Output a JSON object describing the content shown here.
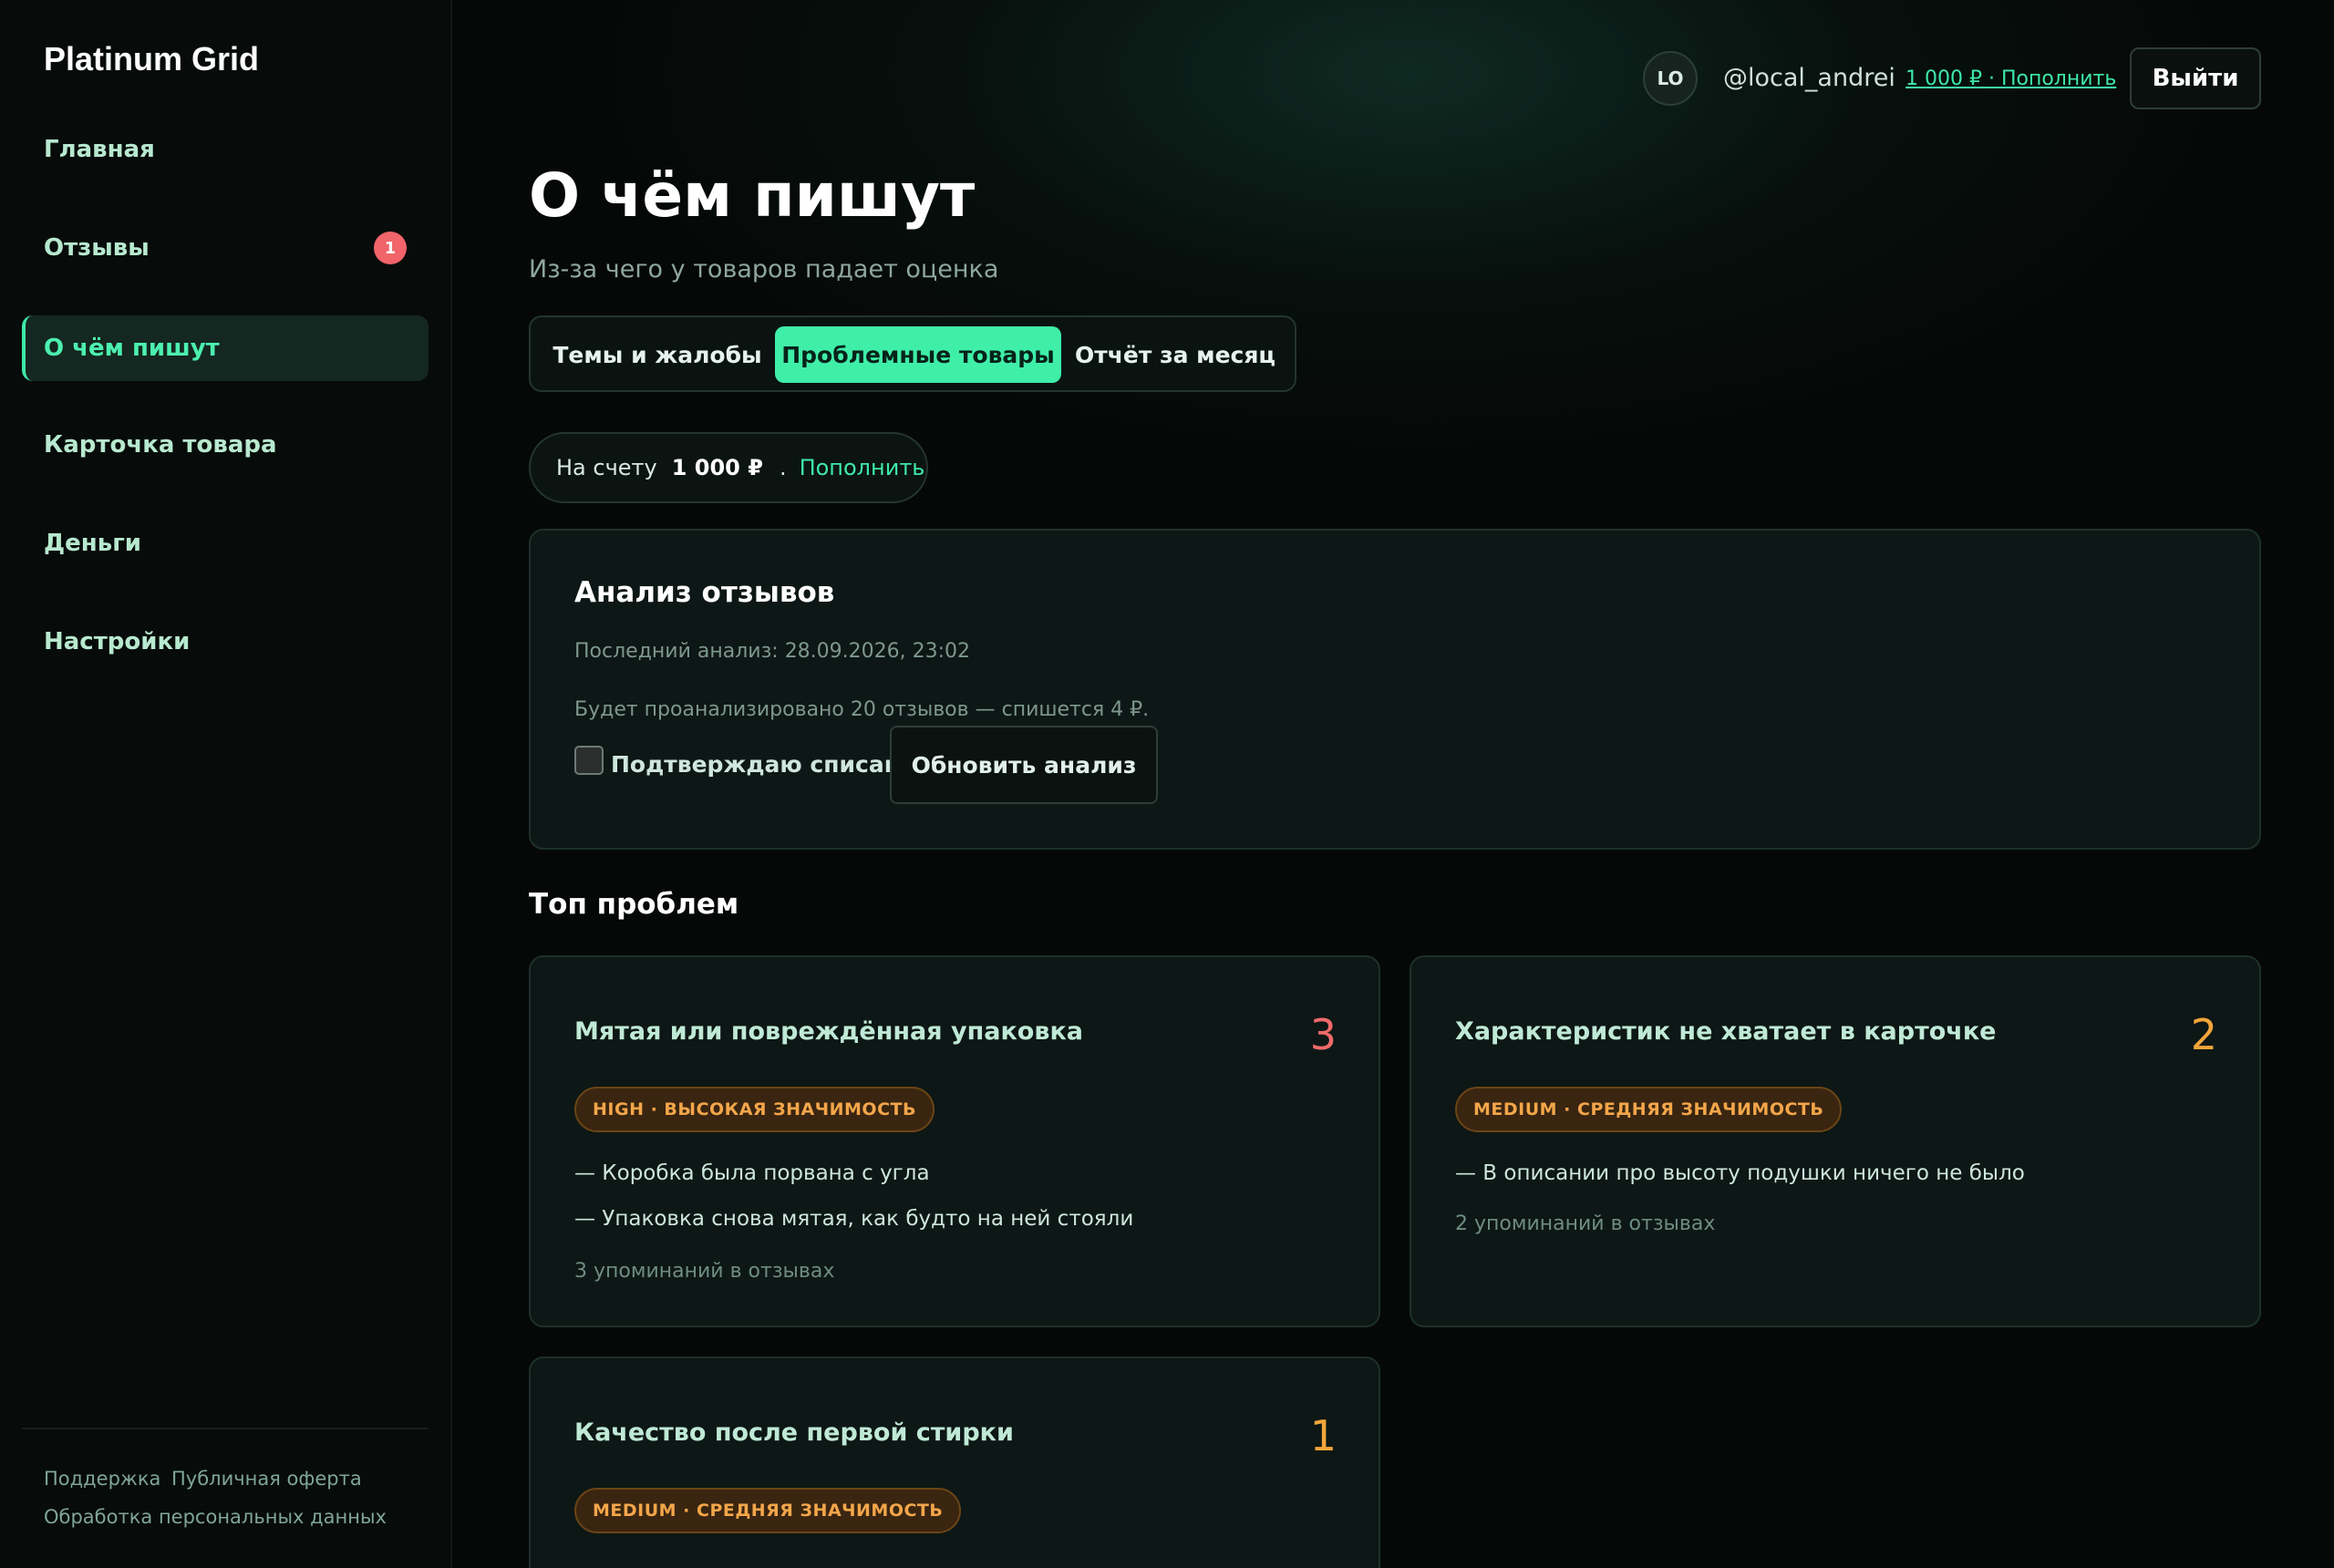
{
  "brand": "Platinum Grid",
  "nav": {
    "items": [
      {
        "label": "Главная"
      },
      {
        "label": "Отзывы",
        "badge": "1"
      },
      {
        "label": "О чём пишут"
      },
      {
        "label": "Карточка товара"
      },
      {
        "label": "Деньги"
      },
      {
        "label": "Настройки"
      }
    ]
  },
  "footer": {
    "support": "Поддержка",
    "offer": "Публичная оферта",
    "privacy": "Обработка персональных данных"
  },
  "header": {
    "avatar_initials": "LO",
    "username": "@local_andrei",
    "balance_link": "1 000 ₽ · Пополнить",
    "logout": "Выйти"
  },
  "page": {
    "title": "О чём пишут",
    "subtitle": "Из-за чего у товаров падает оценка"
  },
  "tabs": [
    {
      "label": "Темы и жалобы"
    },
    {
      "label": "Проблемные товары"
    },
    {
      "label": "Отчёт за месяц"
    }
  ],
  "balance": {
    "label": "На счету",
    "amount": "1 000 ₽",
    "separator": ".",
    "topup": "Пополнить"
  },
  "analysis": {
    "title": "Анализ отзывов",
    "last": "Последний анализ: 28.09.2026, 23:02",
    "will": "Будет проанализировано 20 отзывов — спишется 4 ₽.",
    "confirm": "Подтверждаю списание",
    "refresh": "Обновить анализ"
  },
  "top": {
    "title": "Топ проблем",
    "problems": [
      {
        "title": "Мятая или повреждённая упаковка",
        "count": "3",
        "severity": "HIGH · ВЫСОКАЯ ЗНАЧИМОСТЬ",
        "quotes": [
          "— Коробка была порвана с угла",
          "— Упаковка снова мятая, как будто на ней стояли"
        ],
        "mentions": "3 упоминаний в отзывах"
      },
      {
        "title": "Характеристик не хватает в карточке",
        "count": "2",
        "severity": "MEDIUM · СРЕДНЯЯ ЗНАЧИМОСТЬ",
        "quotes": [
          "— В описании про высоту подушки ничего не было"
        ],
        "mentions": "2 упоминаний в отзывах"
      },
      {
        "title": "Качество после первой стирки",
        "count": "1",
        "severity": "MEDIUM · СРЕДНЯЯ ЗНАЧИМОСТЬ"
      }
    ]
  },
  "colors": {
    "accent": "#3fefa8",
    "high": "#f06a6a",
    "medium": "#f2a53a"
  }
}
